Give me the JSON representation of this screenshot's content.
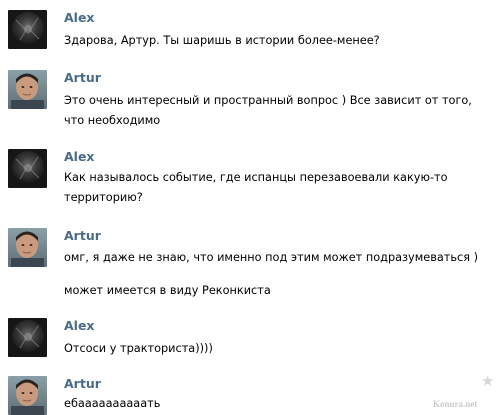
{
  "messages": [
    {
      "author": "Alex",
      "avatar": "alex-dark-avatar",
      "lines": [
        "Здарова, Артур. Ты шаришь в истории более-менее?"
      ]
    },
    {
      "author": "Artur",
      "avatar": "artur-photo-avatar",
      "lines": [
        "Это очень интересный и пространный вопрос ) Все зависит от того, что необходимо"
      ]
    },
    {
      "author": "Alex",
      "avatar": "alex-dark-avatar",
      "lines": [
        "Как называлось событие, где испанцы перезавоевали какую-то территорию?"
      ]
    },
    {
      "author": "Artur",
      "avatar": "artur-photo-avatar",
      "lines": [
        "омг, я даже не знаю, что именно под этим может подразумеваться )",
        "может имеется в виду Реконкиста"
      ]
    },
    {
      "author": "Alex",
      "avatar": "alex-dark-avatar",
      "lines": [
        "Отсоси у тракториста))))"
      ]
    },
    {
      "author": "Artur",
      "avatar": "artur-photo-avatar",
      "lines": [
        "ебаааааааааать"
      ]
    }
  ],
  "icons": {
    "favorite": "star-icon"
  },
  "watermark": "Konura.net",
  "colors": {
    "author_name": "#4a6b8a",
    "text": "#000000",
    "star": "#d6d6d6"
  }
}
